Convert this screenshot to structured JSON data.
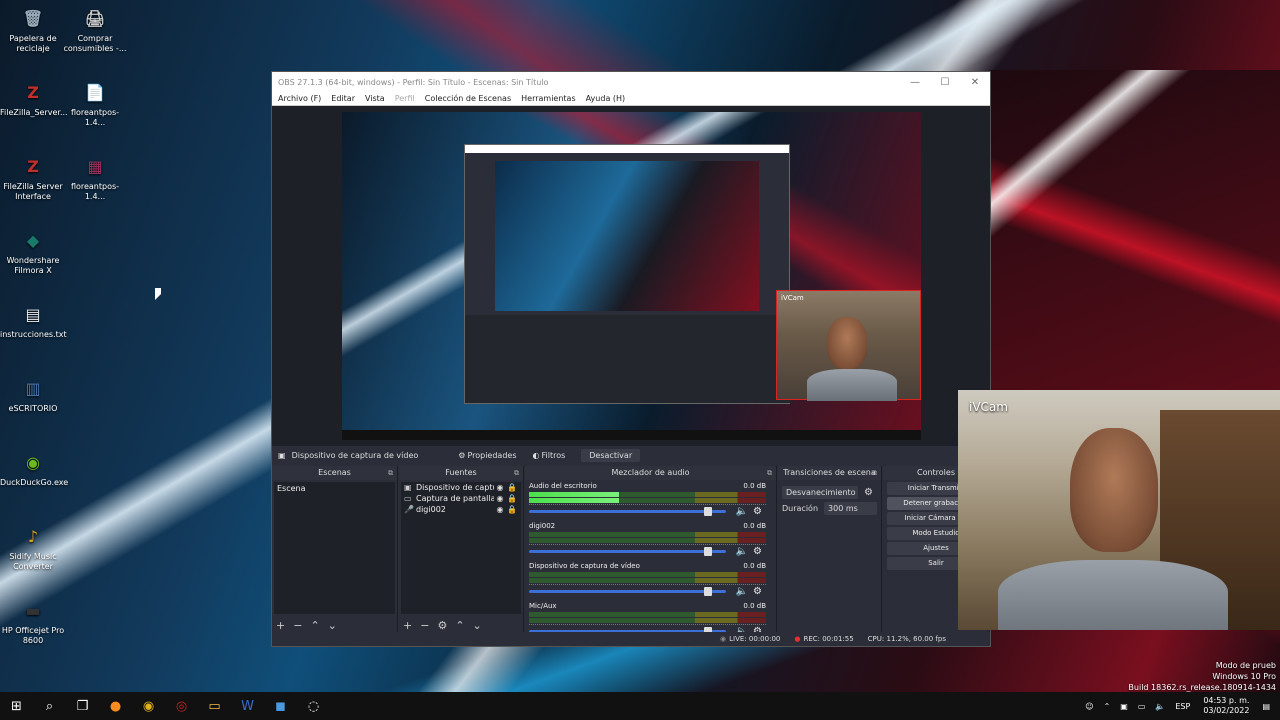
{
  "desktop": {
    "icons": [
      {
        "label": "Papelera de reciclaje",
        "glyph": "🗑",
        "color": "#9ab"
      },
      {
        "label": "Comprar consumibles -...",
        "glyph": "🖨",
        "color": "#ccc"
      },
      {
        "label": "FileZilla_Server...",
        "glyph": "Z",
        "color": "#c0302a"
      },
      {
        "label": "floreantpos-1.4...",
        "glyph": "📄",
        "color": "#eedd88"
      },
      {
        "label": "FileZilla Server Interface",
        "glyph": "Z",
        "color": "#c0302a"
      },
      {
        "label": "floreantpos-1.4...",
        "glyph": "▦",
        "color": "#a03060"
      },
      {
        "label": "Wondershare Filmora X",
        "glyph": "◆",
        "color": "#1a7a6a"
      },
      {
        "label": "instrucciones.txt",
        "glyph": "▤",
        "color": "#eee"
      },
      {
        "label": "eSCRITORIO",
        "glyph": "▥",
        "color": "#4a7ab0"
      },
      {
        "label": "DuckDuckGo.exe",
        "glyph": "◉",
        "color": "#6aba20"
      },
      {
        "label": "Sidify Music Converter",
        "glyph": "♪",
        "color": "#e0a020"
      },
      {
        "label": "HP Officejet Pro 8600",
        "glyph": "▬",
        "color": "#333"
      }
    ]
  },
  "obs": {
    "title": "OBS 27.1.3 (64-bit, windows) - Perfil: Sin Título - Escenas: Sin Título",
    "menu": {
      "archivo": "Archivo (F)",
      "editar": "Editar",
      "vista": "Vista",
      "perfil": "Perfil",
      "coleccion": "Colección de Escenas",
      "herramientas": "Herramientas",
      "ayuda": "Ayuda (H)"
    },
    "preview": {
      "cam_label": "iVCam"
    },
    "source_toolbar": {
      "device": "Dispositivo de captura de vídeo",
      "properties": "Propiedades",
      "filters": "Filtros",
      "deactivate": "Desactivar"
    },
    "docks": {
      "scenes": {
        "title": "Escenas",
        "items": [
          "Escena"
        ]
      },
      "sources": {
        "title": "Fuentes",
        "items": [
          {
            "name": "Dispositivo de captura d",
            "icon": "▣"
          },
          {
            "name": "Captura de pantalla",
            "icon": "▭"
          },
          {
            "name": "digi002",
            "icon": "🎤"
          }
        ]
      },
      "mixer": {
        "title": "Mezclador de audio",
        "tracks": [
          {
            "name": "Audio del escritorio",
            "db": "0.0 dB",
            "level": 0.38,
            "fader": 0.93
          },
          {
            "name": "digi002",
            "db": "0.0 dB",
            "level": 0.0,
            "fader": 0.93
          },
          {
            "name": "Dispositivo de captura de vídeo",
            "db": "0.0 dB",
            "level": 0.0,
            "fader": 0.93
          },
          {
            "name": "Mic/Aux",
            "db": "0.0 dB",
            "level": 0.0,
            "fader": 0.93
          }
        ]
      },
      "transitions": {
        "title": "Transiciones de escena",
        "type": "Desvanecimiento",
        "duration_label": "Duración",
        "duration_value": "300 ms"
      },
      "controls": {
        "title": "Controles",
        "start_stream": "Iniciar Transmisi",
        "stop_record": "Detener grabación",
        "virtual_cam": "Iniciar Cámara Vir",
        "studio_mode": "Modo Estudio",
        "settings": "Ajustes",
        "exit": "Salir"
      }
    },
    "status": {
      "live": "LIVE: 00:00:00",
      "rec": "REC: 00:01:55",
      "cpu": "CPU: 11.2%, 60.00 fps"
    }
  },
  "webcam": {
    "label": "iVCam"
  },
  "watermark": {
    "line1": "Modo de prueb",
    "line2": "Windows 10 Pro",
    "line3": "Build 18362.rs_release.180914-1434"
  },
  "taskbar": {
    "lang": "ESP",
    "time": "04:53 p. m.",
    "date": "03/02/2022"
  }
}
